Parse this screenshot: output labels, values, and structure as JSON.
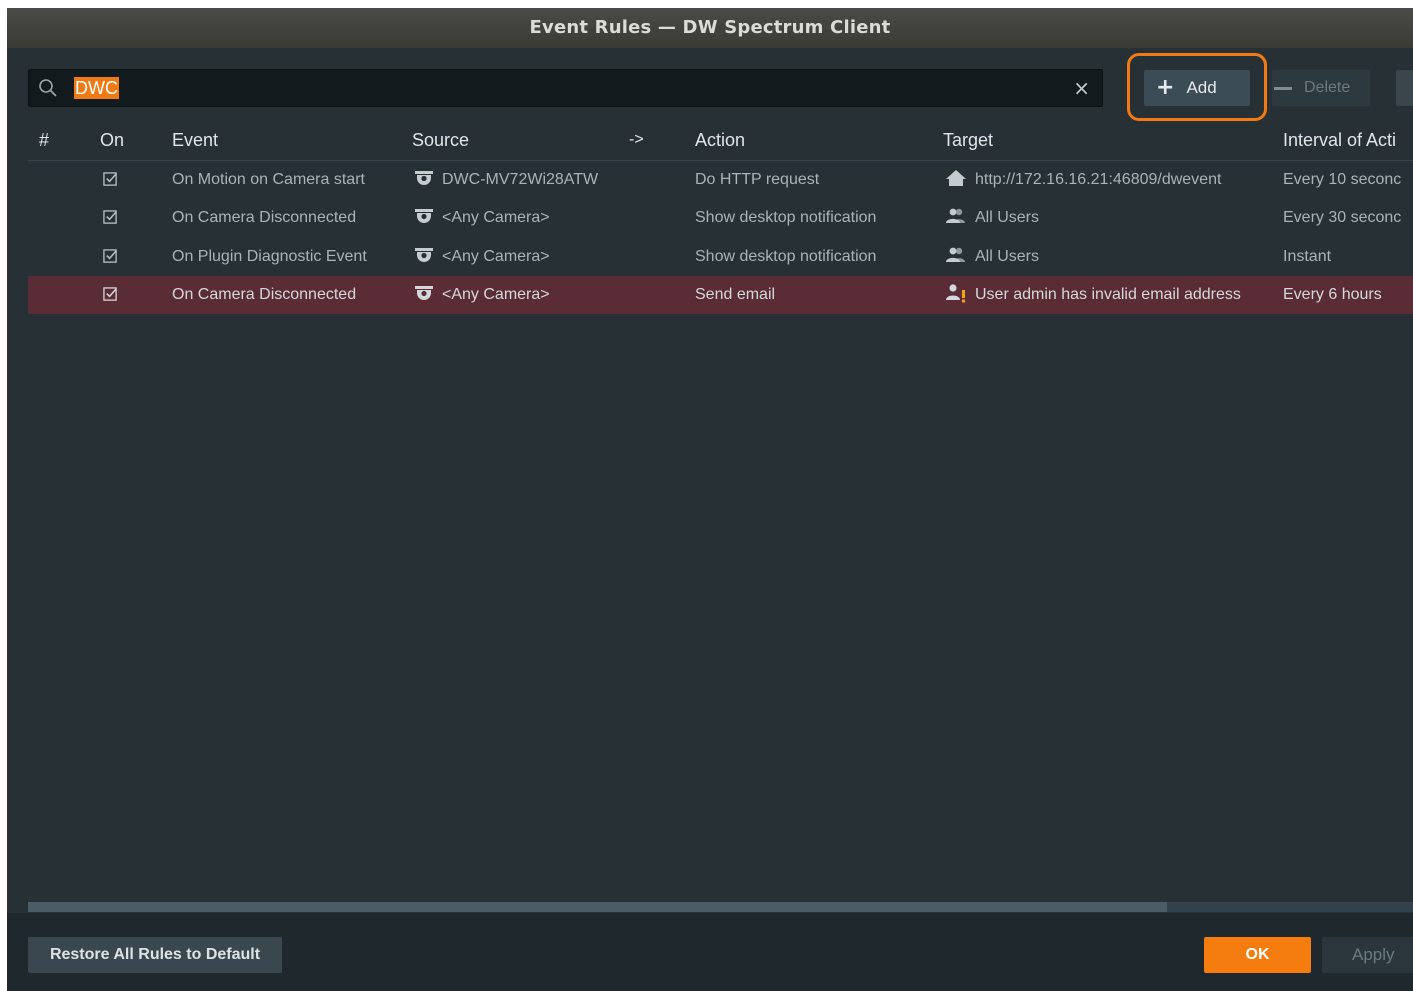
{
  "window": {
    "title": "Event Rules — DW Spectrum Client"
  },
  "search": {
    "value": "DWC",
    "clear_glyph": "×",
    "icon": "search-icon"
  },
  "toolbar": {
    "add_label": "Add",
    "delete_label": "Delete"
  },
  "table": {
    "columns": {
      "num": "#",
      "on": "On",
      "event": "Event",
      "source": "Source",
      "arrow": "->",
      "action": "Action",
      "target": "Target",
      "interval": "Interval of Acti"
    },
    "rows": [
      {
        "on": true,
        "event": "On Motion on Camera start",
        "source": "DWC-MV72Wi28ATW",
        "source_icon": "camera-icon",
        "action": "Do HTTP request",
        "target": "http://172.16.16.21:46809/dwevent",
        "target_icon": "home-icon",
        "interval": "Every 10 seconc",
        "selected": false
      },
      {
        "on": true,
        "event": "On Camera Disconnected",
        "source": "<Any Camera>",
        "source_icon": "camera-icon",
        "action": "Show desktop notification",
        "target": "All Users",
        "target_icon": "users-icon",
        "interval": "Every 30 seconc",
        "selected": false
      },
      {
        "on": true,
        "event": "On Plugin Diagnostic Event",
        "source": "<Any Camera>",
        "source_icon": "camera-icon",
        "action": "Show desktop notification",
        "target": "All Users",
        "target_icon": "users-icon",
        "interval": "Instant",
        "selected": false
      },
      {
        "on": true,
        "event": "On Camera Disconnected",
        "source": "<Any Camera>",
        "source_icon": "camera-icon",
        "action": "Send email",
        "target": "User admin has invalid email address",
        "target_icon": "user-warning-icon",
        "interval": "Every 6 hours",
        "selected": true
      }
    ]
  },
  "footer": {
    "restore_label": "Restore All Rules to Default",
    "ok_label": "OK",
    "apply_label": "Apply"
  },
  "colors": {
    "accent": "#f57c0e",
    "background": "#263035",
    "selected_row": "#5a2c35"
  }
}
